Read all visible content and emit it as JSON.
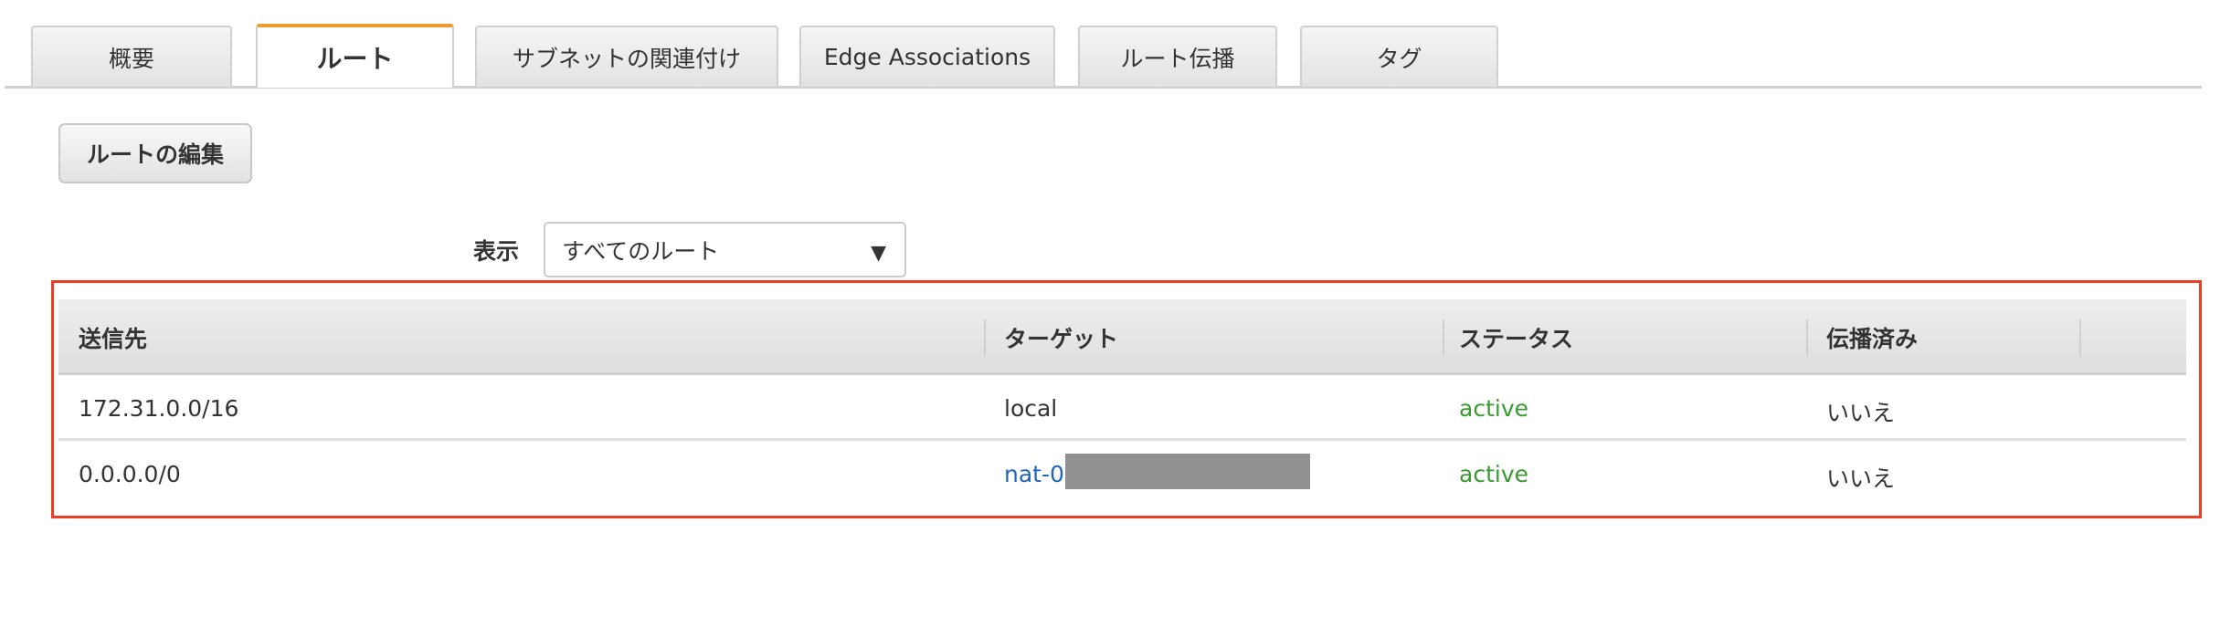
{
  "tabs": [
    {
      "label": "概要",
      "active": false
    },
    {
      "label": "ルート",
      "active": true
    },
    {
      "label": "サブネットの関連付け",
      "active": false
    },
    {
      "label": "Edge Associations",
      "active": false
    },
    {
      "label": "ルート伝播",
      "active": false
    },
    {
      "label": "タグ",
      "active": false
    }
  ],
  "toolbar": {
    "edit_routes_label": "ルートの編集"
  },
  "filter": {
    "label": "表示",
    "selected": "すべてのルート"
  },
  "table": {
    "columns": [
      "送信先",
      "ターゲット",
      "ステータス",
      "伝播済み"
    ],
    "rows": [
      {
        "destination": "172.31.0.0/16",
        "target": "local",
        "status": "active",
        "propagated": "いいえ"
      },
      {
        "destination": "0.0.0.0/0",
        "target": "nat-0",
        "status": "active",
        "propagated": "いいえ"
      }
    ]
  },
  "colors": {
    "accent_tab": "#f0992f",
    "status_active": "#3a9a32",
    "link": "#1f65b8",
    "highlight_box": "#ea3f24"
  }
}
